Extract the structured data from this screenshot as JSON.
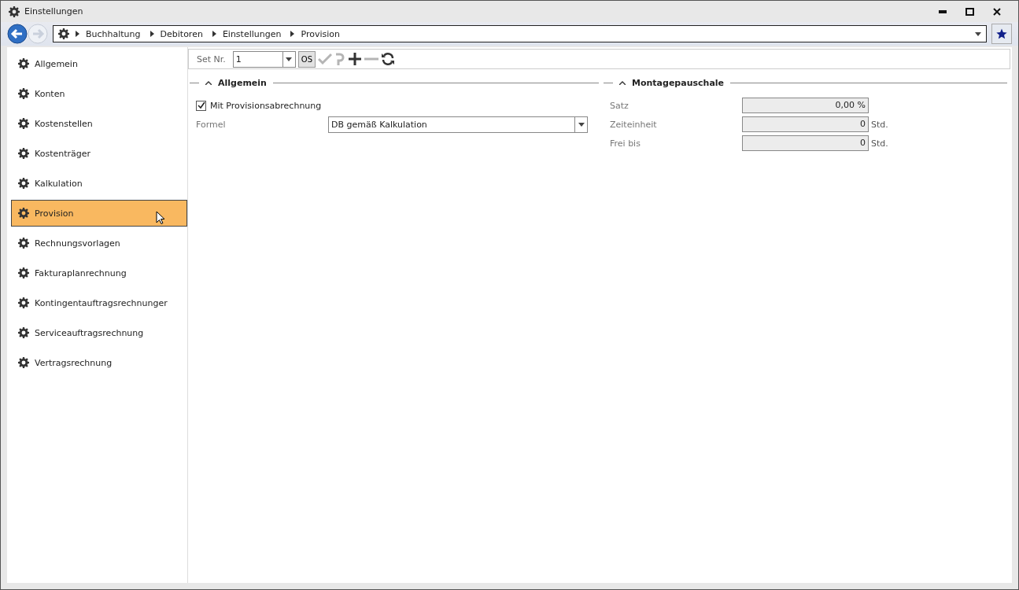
{
  "window": {
    "title": "Einstellungen"
  },
  "breadcrumb": [
    "Buchhaltung",
    "Debitoren",
    "Einstellungen",
    "Provision"
  ],
  "sidebar": {
    "items": [
      {
        "label": "Allgemein",
        "selected": false
      },
      {
        "label": "Konten",
        "selected": false
      },
      {
        "label": "Kostenstellen",
        "selected": false
      },
      {
        "label": "Kostenträger",
        "selected": false
      },
      {
        "label": "Kalkulation",
        "selected": false
      },
      {
        "label": "Provision",
        "selected": true
      },
      {
        "label": "Rechnungsvorlagen",
        "selected": false
      },
      {
        "label": "Fakturaplanrechnung",
        "selected": false
      },
      {
        "label": "Kontingentauftragsrechnunger",
        "selected": false
      },
      {
        "label": "Serviceauftragsrechnung",
        "selected": false
      },
      {
        "label": "Vertragsrechnung",
        "selected": false
      }
    ]
  },
  "toolbar": {
    "set_label": "Set Nr.",
    "set_value": "1",
    "os_button": "OS"
  },
  "allgemein": {
    "title": "Allgemein",
    "checkbox": {
      "label": "Mit Provisionsabrechnung",
      "checked": true
    },
    "formel_label": "Formel",
    "formel_value": "DB gemäß Kalkulation"
  },
  "montagepauschale": {
    "title": "Montagepauschale",
    "fields": [
      {
        "label": "Satz",
        "value": "0,00 %"
      },
      {
        "label": "Zeiteinheit",
        "value": "0",
        "unit": "Std."
      },
      {
        "label": "Frei bis",
        "value": "0",
        "unit": "Std."
      }
    ]
  }
}
